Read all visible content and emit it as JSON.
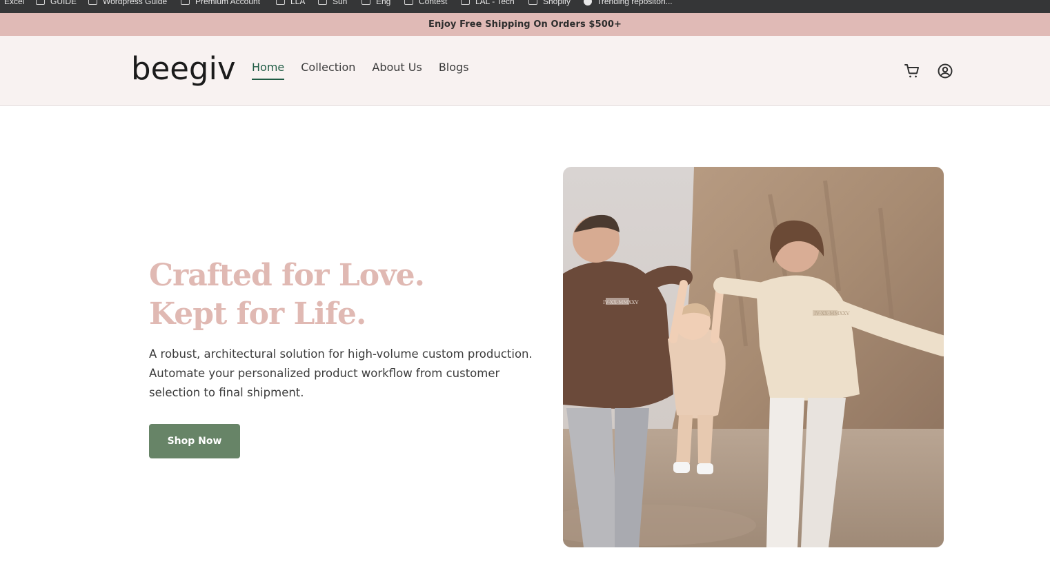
{
  "browser": {
    "bookmarks": [
      {
        "label": "Excel",
        "icon": "none"
      },
      {
        "label": "GUIDE",
        "icon": "folder-icon"
      },
      {
        "label": "Wordpress Guide",
        "icon": "folder-icon"
      },
      {
        "label": "Premium Account",
        "icon": "folder-icon"
      },
      {
        "label": "LLA",
        "icon": "folder-icon"
      },
      {
        "label": "Sun",
        "icon": "folder-icon"
      },
      {
        "label": "Eng",
        "icon": "folder-icon"
      },
      {
        "label": "Contest",
        "icon": "folder-icon"
      },
      {
        "label": "LAL - Tech",
        "icon": "folder-icon"
      },
      {
        "label": "Shopify",
        "icon": "folder-icon"
      },
      {
        "label": "Trending repositori...",
        "icon": "github-icon"
      }
    ]
  },
  "announcement": {
    "text": "Enjoy Free Shipping On Orders $500+"
  },
  "header": {
    "logo": "beegiv",
    "nav": [
      {
        "label": "Home",
        "active": true
      },
      {
        "label": "Collection",
        "active": false
      },
      {
        "label": "About Us",
        "active": false
      },
      {
        "label": "Blogs",
        "active": false
      }
    ],
    "icons": [
      "cart-icon",
      "account-icon"
    ]
  },
  "hero": {
    "title_line1": "Crafted for Love.",
    "title_line2": "Kept for Life.",
    "description": "A robust, architectural solution for high-volume custom production. Automate your personalized product workflow from customer selection to final shipment.",
    "cta_label": "Shop Now",
    "sweatshirt_print": "IV·XX·MMXXV"
  },
  "colors": {
    "accent_green": "#1f5b44",
    "button_green": "#678467",
    "title_pink": "#e0b9b3",
    "announcement_bg": "#e0bab6",
    "header_bg": "#f8f2f1"
  }
}
